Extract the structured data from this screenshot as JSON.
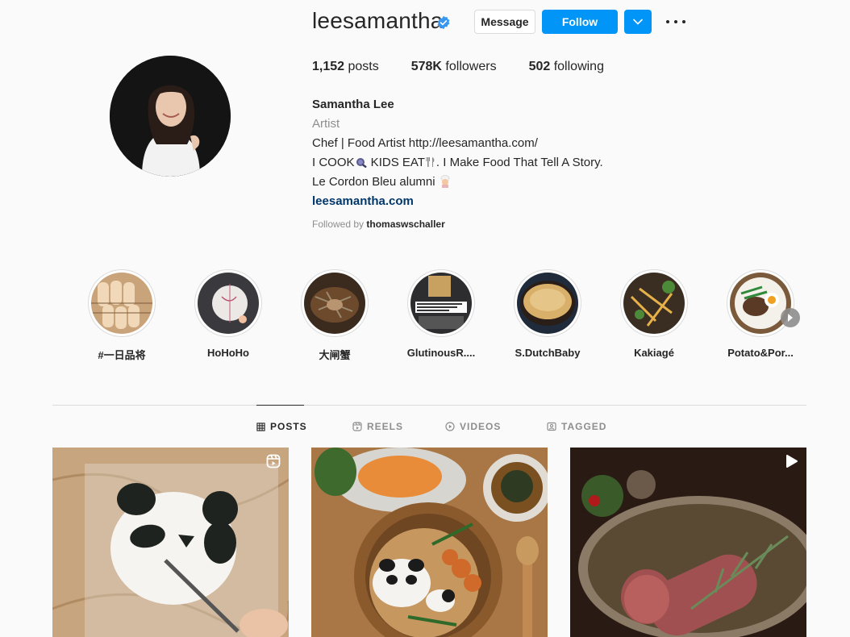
{
  "profile": {
    "username": "leesamantha",
    "verified_icon": "verified-badge-icon",
    "message_label": "Message",
    "follow_label": "Follow",
    "accent_color": "#0095f6"
  },
  "stats": {
    "posts_count": "1,152",
    "posts_label": " posts",
    "followers_count": "578K",
    "followers_label": " followers",
    "following_count": "502",
    "following_label": " following"
  },
  "bio": {
    "full_name": "Samantha Lee",
    "category": "Artist",
    "line1": "Chef | Food Artist http://leesamantha.com/",
    "line2_a": "I COOK",
    "line2_b": " KIDS EAT",
    "line2_c": ". I Make Food That Tell A Story.",
    "line3": "Le Cordon Bleu alumni",
    "website": "leesamantha.com",
    "followed_by_prefix": "Followed by ",
    "followed_by_user": "thomaswschaller"
  },
  "highlights": [
    {
      "label": "#一日品将"
    },
    {
      "label": "HoHoHo"
    },
    {
      "label": "大闸蟹"
    },
    {
      "label": "GlutinousR...."
    },
    {
      "label": "S.DutchBaby"
    },
    {
      "label": "Kakiagé"
    },
    {
      "label": "Potato&Por..."
    }
  ],
  "tabs": [
    {
      "label": "POSTS",
      "icon": "grid-icon",
      "active": true
    },
    {
      "label": "REELS",
      "icon": "reels-icon",
      "active": false
    },
    {
      "label": "VIDEOS",
      "icon": "video-play-icon",
      "active": false
    },
    {
      "label": "TAGGED",
      "icon": "tagged-icon",
      "active": false
    }
  ],
  "posts": [
    {
      "badge": "reels-icon"
    },
    {
      "badge": ""
    },
    {
      "badge": "video-play-icon"
    }
  ]
}
